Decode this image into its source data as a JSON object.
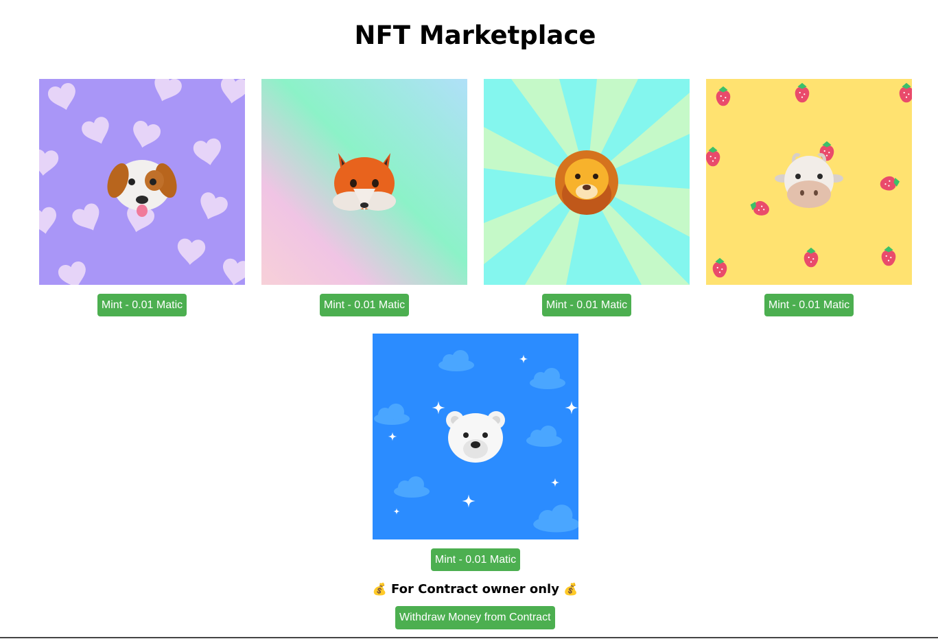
{
  "page": {
    "title": "NFT Marketplace"
  },
  "nfts": [
    {
      "animal": "dog",
      "background": "purple-hearts",
      "mint_label": "Mint - 0.01 Matic"
    },
    {
      "animal": "fox",
      "background": "pastel-gradient",
      "mint_label": "Mint - 0.01 Matic"
    },
    {
      "animal": "lion",
      "background": "sunburst",
      "mint_label": "Mint - 0.01 Matic"
    },
    {
      "animal": "cow",
      "background": "yellow-strawberries",
      "mint_label": "Mint - 0.01 Matic"
    },
    {
      "animal": "polar-bear",
      "background": "blue-sky-clouds",
      "mint_label": "Mint - 0.01 Matic"
    }
  ],
  "owner_section": {
    "icon": "money-bag-icon",
    "label": "For Contract owner only",
    "withdraw_label": "Withdraw Money from Contract"
  },
  "colors": {
    "button": "#4caf50",
    "button_text": "#ffffff"
  }
}
